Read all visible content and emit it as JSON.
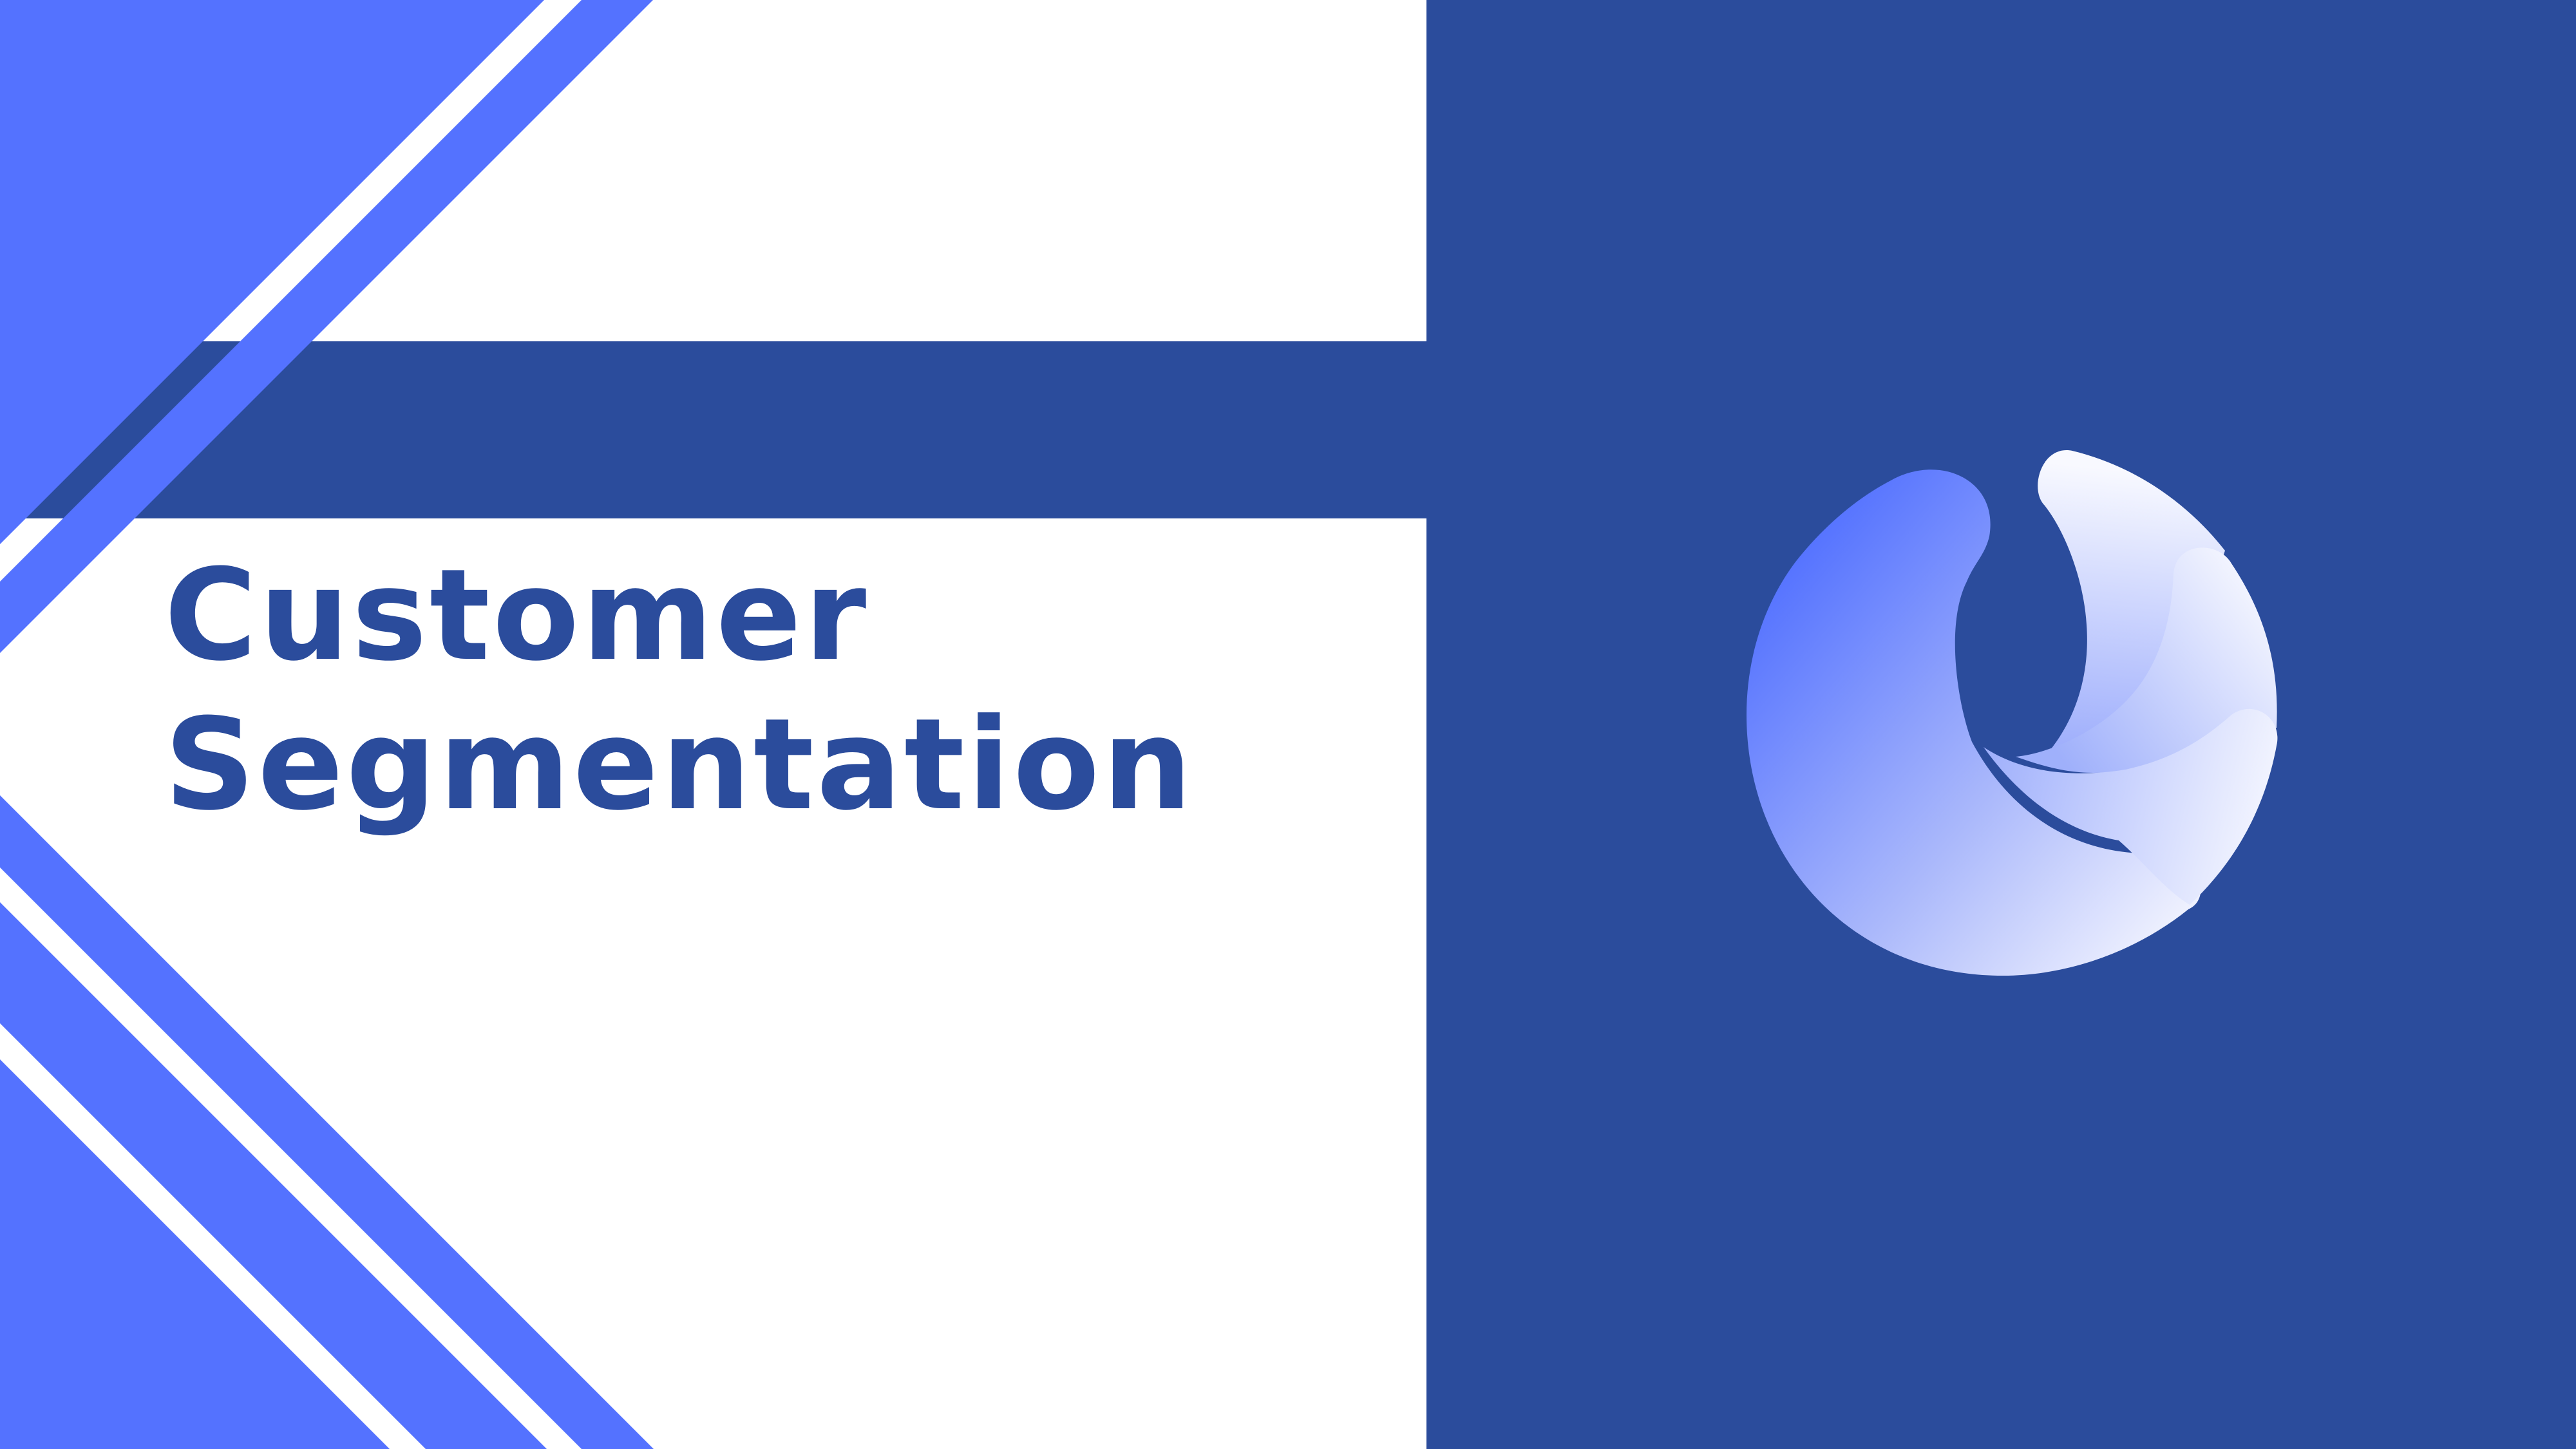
{
  "slide": {
    "title_line_1": "Customer",
    "title_line_2": "Segmentation"
  },
  "colors": {
    "primary_dark": "#2b4c9c",
    "primary_light": "#5472ff",
    "background": "#ffffff"
  },
  "icons": {
    "logo": "circular-segments-logo-icon"
  }
}
